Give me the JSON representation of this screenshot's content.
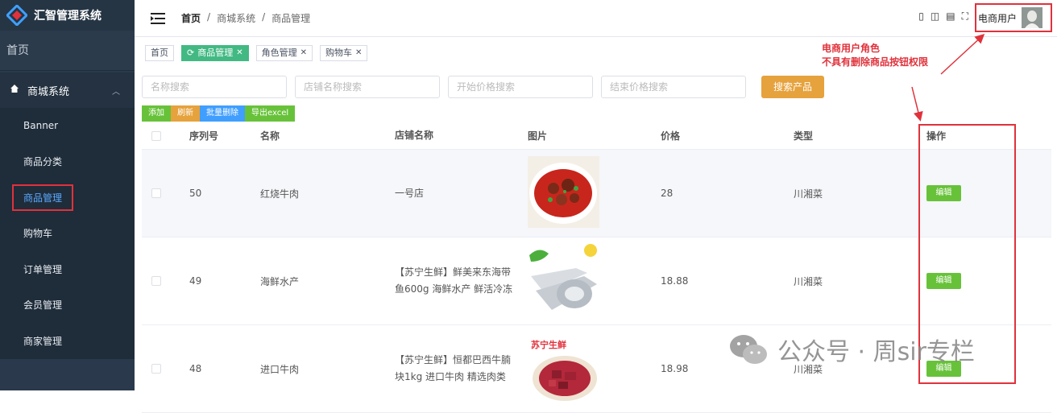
{
  "app": {
    "title": "汇智管理系统"
  },
  "sidebar": {
    "home": "首页",
    "group": "商城系统",
    "items": [
      {
        "label": "Banner"
      },
      {
        "label": "商品分类"
      },
      {
        "label": "商品管理"
      },
      {
        "label": "购物车"
      },
      {
        "label": "订单管理"
      },
      {
        "label": "会员管理"
      },
      {
        "label": "商家管理"
      }
    ]
  },
  "header": {
    "breadcrumb": [
      "首页",
      "/",
      "商城系统",
      "/",
      "商品管理"
    ],
    "user_name": "电商用户"
  },
  "tags": [
    {
      "label": "首页",
      "closable": false
    },
    {
      "label": "商品管理",
      "closable": true
    },
    {
      "label": "角色管理",
      "closable": true
    },
    {
      "label": "购物车",
      "closable": true
    }
  ],
  "annotation": {
    "line1": "电商用户角色",
    "line2": "不具有删除商品按钮权限"
  },
  "search": {
    "name_placeholder": "名称搜索",
    "shop_placeholder": "店铺名称搜索",
    "min_price_placeholder": "开始价格搜索",
    "max_price_placeholder": "结束价格搜索",
    "button": "搜索产品"
  },
  "actions": {
    "add": "添加",
    "refresh": "刷新",
    "batch_delete": "批量删除",
    "export": "导出excel"
  },
  "table": {
    "headers": {
      "seq": "序列号",
      "name": "名称",
      "shop": "店铺名称",
      "image": "图片",
      "price": "价格",
      "type": "类型",
      "op": "操作"
    },
    "rows": [
      {
        "seq": "50",
        "name": "红烧牛肉",
        "shop": "一号店",
        "price": "28",
        "type": "川湘菜",
        "edit": "编辑"
      },
      {
        "seq": "49",
        "name": "海鲜水产",
        "shop": "【苏宁生鲜】鲜美来东海带鱼600g 海鲜水产 鲜活冷冻",
        "price": "18.88",
        "type": "川湘菜",
        "edit": "编辑"
      },
      {
        "seq": "48",
        "name": "进口牛肉",
        "shop": "【苏宁生鲜】恒都巴西牛腩块1kg 进口牛肉 精选肉类",
        "price": "18.98",
        "type": "川湘菜",
        "edit": "编辑",
        "image_label": "苏宁生鲜"
      }
    ]
  },
  "watermark": {
    "text": "公众号 · 周sir专栏"
  },
  "colors": {
    "sidebar": "#2a3a4c",
    "active_tag": "#42b983",
    "annotation": "#e0323c",
    "link_active": "#5aa9ff"
  }
}
